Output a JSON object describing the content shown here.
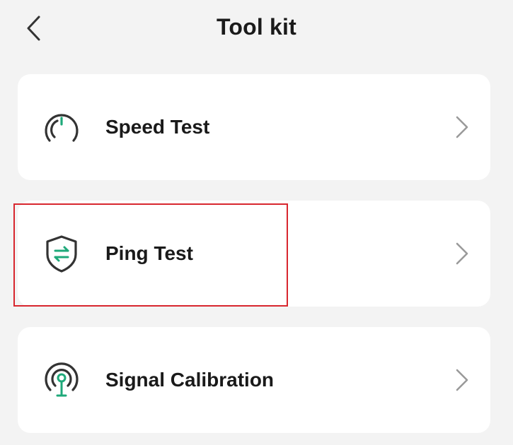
{
  "header": {
    "title": "Tool kit",
    "back_icon": "chevron-left-icon"
  },
  "tools": [
    {
      "label": "Speed Test",
      "icon": "speedometer-icon"
    },
    {
      "label": "Ping Test",
      "icon": "shield-transfer-icon"
    },
    {
      "label": "Signal Calibration",
      "icon": "signal-antenna-icon"
    }
  ],
  "colors": {
    "background": "#f3f3f3",
    "card": "#ffffff",
    "accent": "#1fa97a",
    "highlight": "#d8262e",
    "chevron": "#9a9a9a"
  }
}
